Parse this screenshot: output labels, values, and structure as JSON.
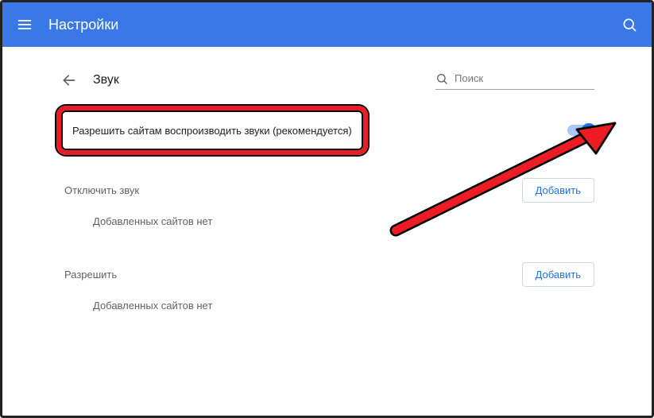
{
  "appbar": {
    "title": "Настройки"
  },
  "page": {
    "title": "Звук",
    "search_placeholder": "Поиск",
    "main_setting": "Разрешить сайтам воспроизводить звуки (рекомендуется)"
  },
  "sections": {
    "mute": {
      "title": "Отключить звук",
      "add": "Добавить",
      "empty": "Добавленных сайтов нет"
    },
    "allow": {
      "title": "Разрешить",
      "add": "Добавить",
      "empty": "Добавленных сайтов нет"
    }
  }
}
